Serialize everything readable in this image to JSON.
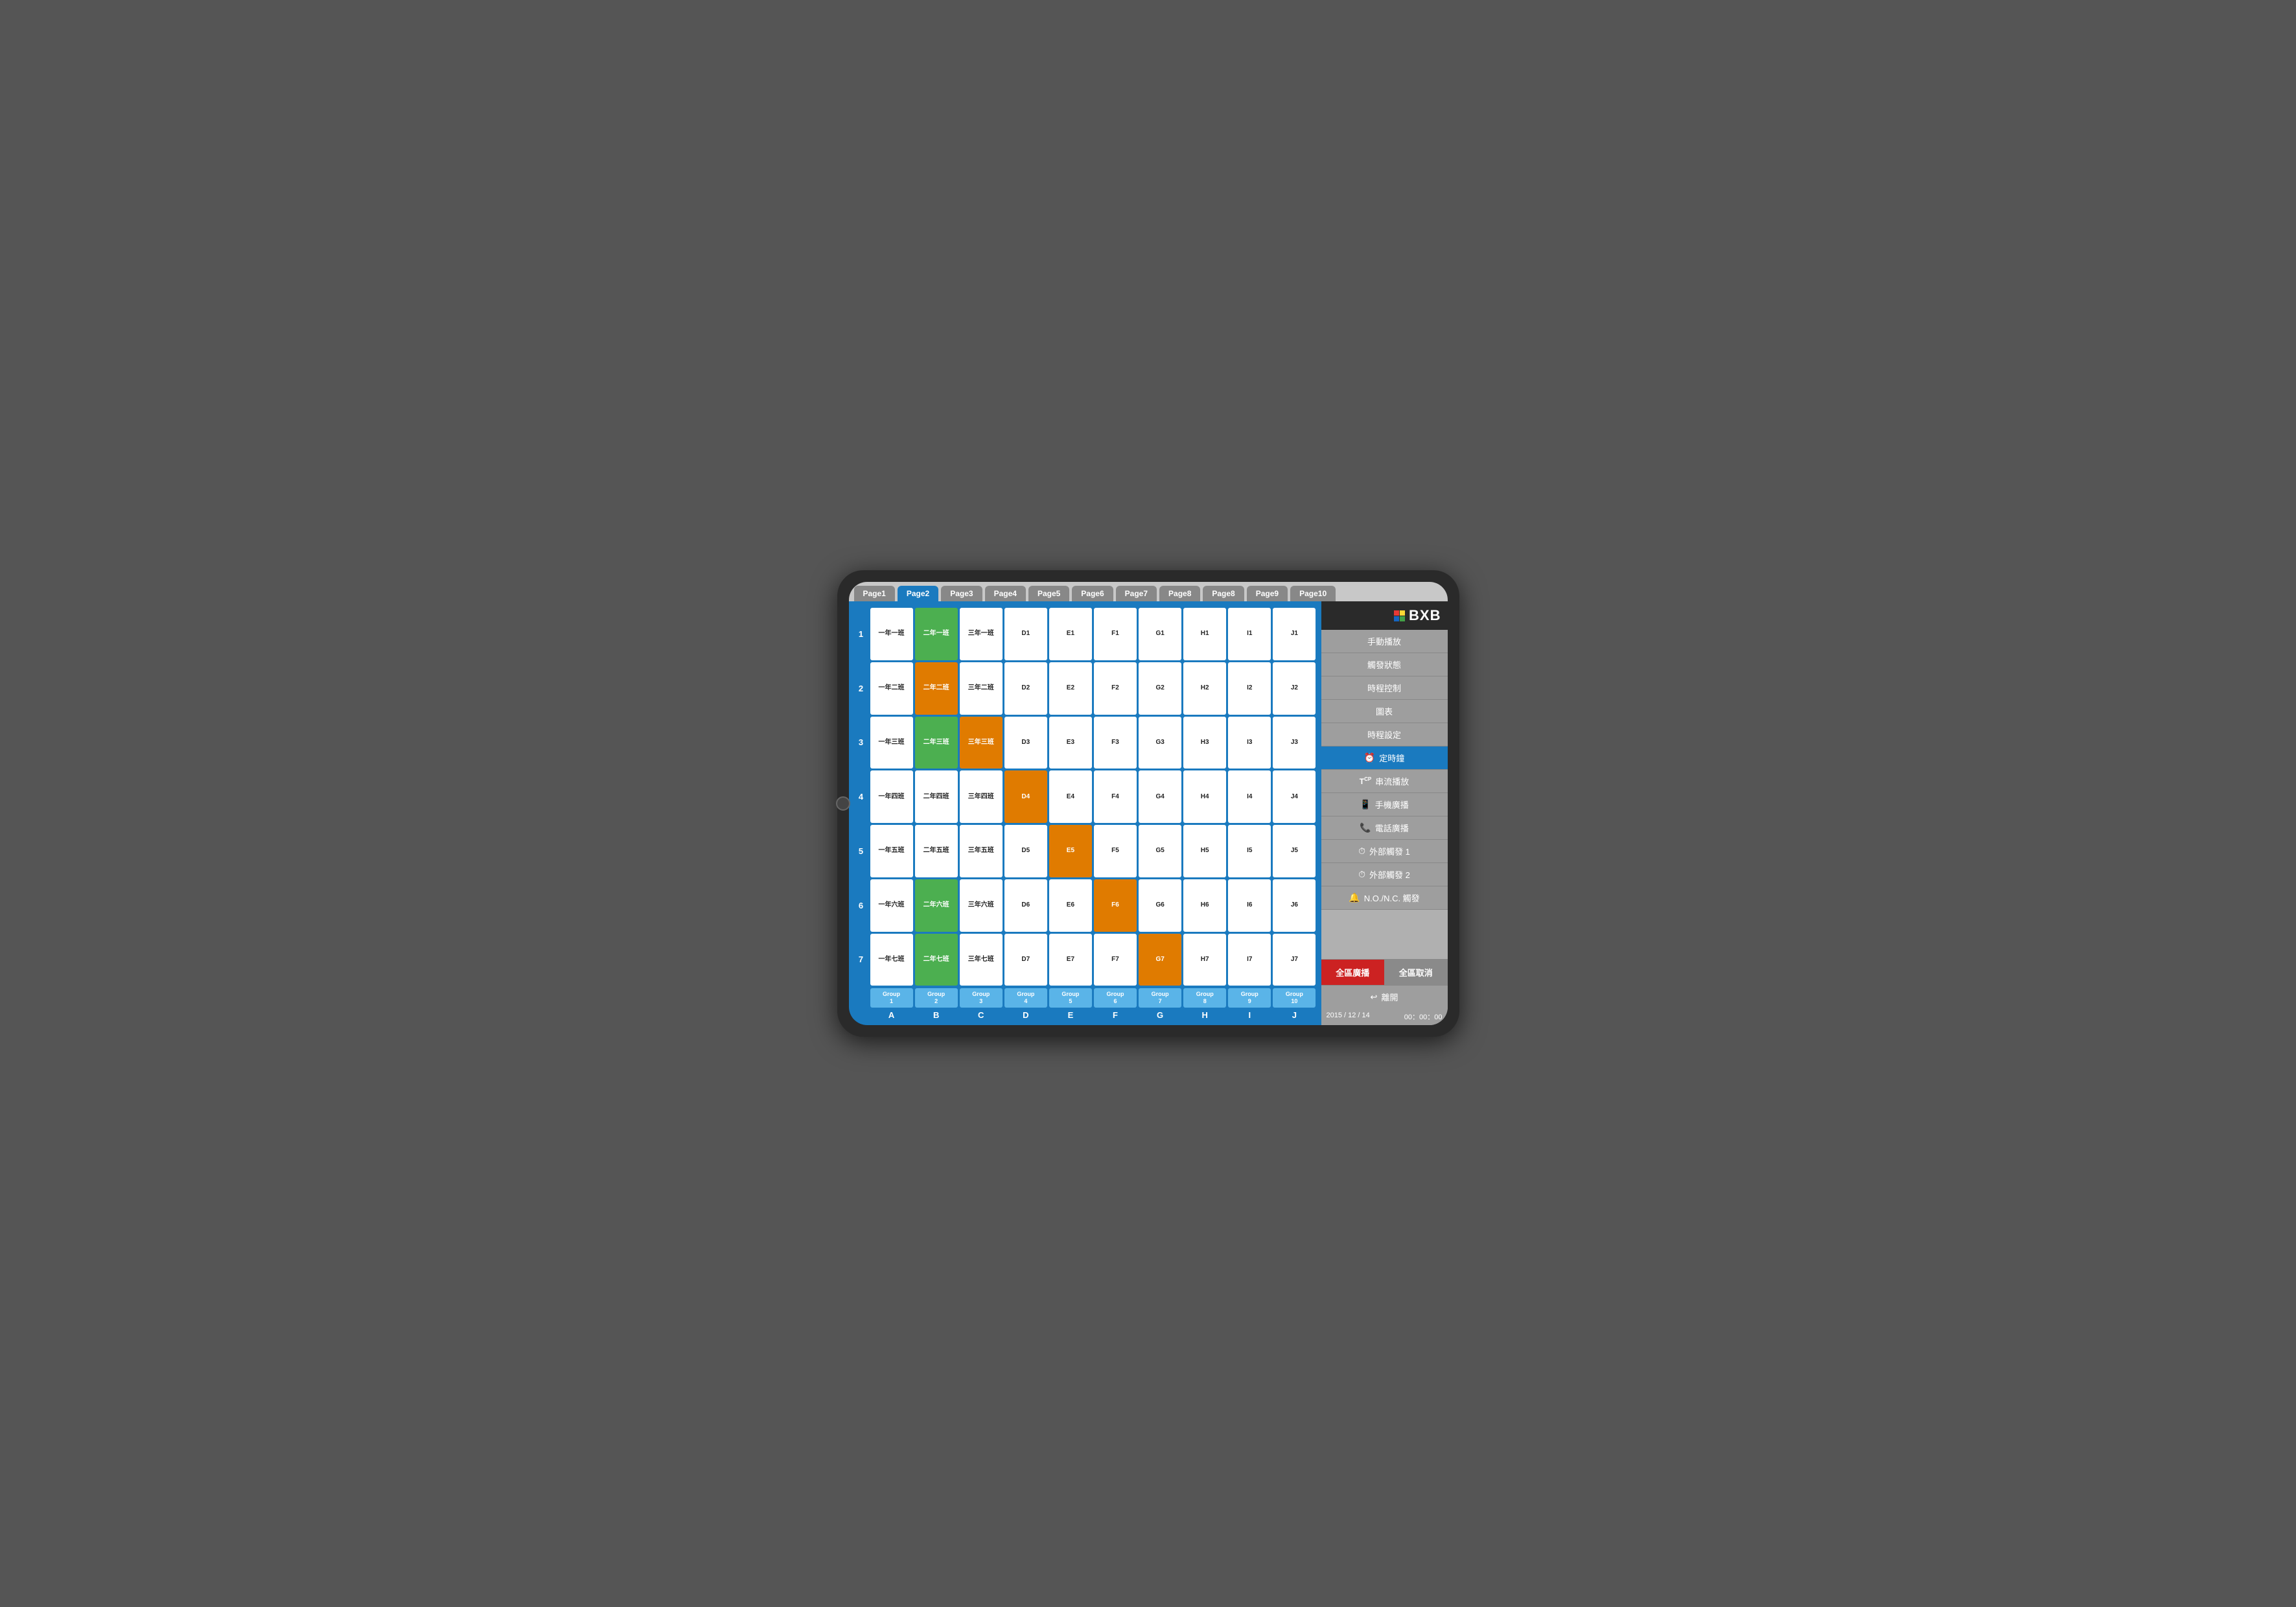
{
  "tabs": [
    {
      "label": "Page1",
      "active": false
    },
    {
      "label": "Page2",
      "active": true
    },
    {
      "label": "Page3",
      "active": false
    },
    {
      "label": "Page4",
      "active": false
    },
    {
      "label": "Page5",
      "active": false
    },
    {
      "label": "Page6",
      "active": false
    },
    {
      "label": "Page7",
      "active": false
    },
    {
      "label": "Page8",
      "active": false
    },
    {
      "label": "Page8",
      "active": false
    },
    {
      "label": "Page9",
      "active": false
    },
    {
      "label": "Page10",
      "active": false
    }
  ],
  "rows": [
    {
      "num": "1",
      "cells": [
        {
          "label": "一年一班",
          "color": "white"
        },
        {
          "label": "二年一班",
          "color": "green"
        },
        {
          "label": "三年一班",
          "color": "white"
        },
        {
          "label": "D1",
          "color": "white"
        },
        {
          "label": "E1",
          "color": "white"
        },
        {
          "label": "F1",
          "color": "white"
        },
        {
          "label": "G1",
          "color": "white"
        },
        {
          "label": "H1",
          "color": "white"
        },
        {
          "label": "I1",
          "color": "white"
        },
        {
          "label": "J1",
          "color": "white"
        }
      ]
    },
    {
      "num": "2",
      "cells": [
        {
          "label": "一年二班",
          "color": "white"
        },
        {
          "label": "二年二班",
          "color": "orange"
        },
        {
          "label": "三年二班",
          "color": "white"
        },
        {
          "label": "D2",
          "color": "white"
        },
        {
          "label": "E2",
          "color": "white"
        },
        {
          "label": "F2",
          "color": "white"
        },
        {
          "label": "G2",
          "color": "white"
        },
        {
          "label": "H2",
          "color": "white"
        },
        {
          "label": "I2",
          "color": "white"
        },
        {
          "label": "J2",
          "color": "white"
        }
      ]
    },
    {
      "num": "3",
      "cells": [
        {
          "label": "一年三班",
          "color": "white"
        },
        {
          "label": "二年三班",
          "color": "green"
        },
        {
          "label": "三年三班",
          "color": "orange"
        },
        {
          "label": "D3",
          "color": "white"
        },
        {
          "label": "E3",
          "color": "white"
        },
        {
          "label": "F3",
          "color": "white"
        },
        {
          "label": "G3",
          "color": "white"
        },
        {
          "label": "H3",
          "color": "white"
        },
        {
          "label": "I3",
          "color": "white"
        },
        {
          "label": "J3",
          "color": "white"
        }
      ]
    },
    {
      "num": "4",
      "cells": [
        {
          "label": "一年四班",
          "color": "white"
        },
        {
          "label": "二年四班",
          "color": "white"
        },
        {
          "label": "三年四班",
          "color": "white"
        },
        {
          "label": "D4",
          "color": "orange"
        },
        {
          "label": "E4",
          "color": "white"
        },
        {
          "label": "F4",
          "color": "white"
        },
        {
          "label": "G4",
          "color": "white"
        },
        {
          "label": "H4",
          "color": "white"
        },
        {
          "label": "I4",
          "color": "white"
        },
        {
          "label": "J4",
          "color": "white"
        }
      ]
    },
    {
      "num": "5",
      "cells": [
        {
          "label": "一年五班",
          "color": "white"
        },
        {
          "label": "二年五班",
          "color": "white"
        },
        {
          "label": "三年五班",
          "color": "white"
        },
        {
          "label": "D5",
          "color": "white"
        },
        {
          "label": "E5",
          "color": "orange"
        },
        {
          "label": "F5",
          "color": "white"
        },
        {
          "label": "G5",
          "color": "white"
        },
        {
          "label": "H5",
          "color": "white"
        },
        {
          "label": "I5",
          "color": "white"
        },
        {
          "label": "J5",
          "color": "white"
        }
      ]
    },
    {
      "num": "6",
      "cells": [
        {
          "label": "一年六班",
          "color": "white"
        },
        {
          "label": "二年六班",
          "color": "green"
        },
        {
          "label": "三年六班",
          "color": "white"
        },
        {
          "label": "D6",
          "color": "white"
        },
        {
          "label": "E6",
          "color": "white"
        },
        {
          "label": "F6",
          "color": "orange"
        },
        {
          "label": "G6",
          "color": "white"
        },
        {
          "label": "H6",
          "color": "white"
        },
        {
          "label": "I6",
          "color": "white"
        },
        {
          "label": "J6",
          "color": "white"
        }
      ]
    },
    {
      "num": "7",
      "cells": [
        {
          "label": "一年七班",
          "color": "white"
        },
        {
          "label": "二年七班",
          "color": "green"
        },
        {
          "label": "三年七班",
          "color": "white"
        },
        {
          "label": "D7",
          "color": "white"
        },
        {
          "label": "E7",
          "color": "white"
        },
        {
          "label": "F7",
          "color": "white"
        },
        {
          "label": "G7",
          "color": "orange"
        },
        {
          "label": "H7",
          "color": "white"
        },
        {
          "label": "I7",
          "color": "white"
        },
        {
          "label": "J7",
          "color": "white"
        }
      ]
    }
  ],
  "groups": [
    "Group\n1",
    "Group\n2",
    "Group\n3",
    "Group\n4",
    "Group\n5",
    "Group\n6",
    "Group\n7",
    "Group\n8",
    "Group\n9",
    "Group\n10"
  ],
  "col_labels": [
    "A",
    "B",
    "C",
    "D",
    "E",
    "F",
    "G",
    "H",
    "I",
    "J"
  ],
  "sidebar": {
    "menu_items": [
      {
        "label": "手動播放",
        "icon": "",
        "active": false
      },
      {
        "label": "觸發狀態",
        "icon": "",
        "active": false
      },
      {
        "label": "時程控制",
        "icon": "",
        "active": false
      },
      {
        "label": "圖表",
        "icon": "",
        "active": false
      },
      {
        "label": "時程設定",
        "icon": "",
        "active": false
      },
      {
        "label": "定時鐘",
        "icon": "⏰",
        "active": true
      },
      {
        "label": "串流播放",
        "icon": "T",
        "active": false
      },
      {
        "label": "手機廣播",
        "icon": "📱",
        "active": false
      },
      {
        "label": "電話廣播",
        "icon": "📞",
        "active": false
      },
      {
        "label": "外部觸發 1",
        "icon": "⏱",
        "active": false
      },
      {
        "label": "外部觸發 2",
        "icon": "⏱",
        "active": false
      },
      {
        "label": "N.O./N.C. 觸發",
        "icon": "🔔",
        "active": false
      }
    ],
    "broadcast_label": "全區廣播",
    "cancel_all_label": "全區取消",
    "exit_label": "離開",
    "datetime": "2015 / 12 / 14",
    "time": "00：00：00"
  }
}
